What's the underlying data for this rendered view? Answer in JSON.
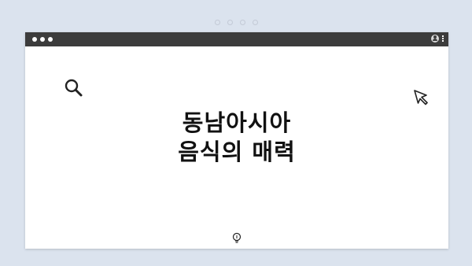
{
  "page": {
    "title_line1": "동남아시아",
    "title_line2": "음식의 매력"
  },
  "colors": {
    "background": "#dbe3ee",
    "titlebar": "#3c3c3c",
    "content": "#ffffff",
    "text": "#111111"
  },
  "icons": {
    "top_dots": "pager-dots",
    "window_controls": "window-dots",
    "profile": "user-icon",
    "menu": "kebab-icon",
    "search": "search-icon",
    "cursor": "cursor-icon",
    "bottom": "lightbulb-icon"
  }
}
